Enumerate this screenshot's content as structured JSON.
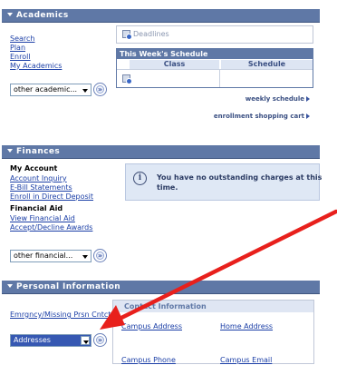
{
  "academics": {
    "title": "Academics",
    "links": [
      "Search",
      "Plan",
      "Enroll",
      "My Academics"
    ],
    "dropdown_value": "other academic...",
    "deadlines_label": "Deadlines",
    "schedule_title": "This Week's Schedule",
    "schedule_columns": [
      "Class",
      "Schedule"
    ],
    "weekly_schedule_link": "weekly schedule",
    "shopping_cart_link": "enrollment shopping cart"
  },
  "finances": {
    "title": "Finances",
    "my_account_heading": "My Account",
    "my_account_links": [
      "Account Inquiry",
      "E-Bill Statements",
      "Enroll in Direct Deposit"
    ],
    "financial_aid_heading": "Financial Aid",
    "financial_aid_links": [
      "View Financial Aid",
      "Accept/Decline Awards"
    ],
    "dropdown_value": "other financial...",
    "notice_line1": "You have no outstanding charges at this",
    "notice_line2": "time."
  },
  "personal": {
    "title": "Personal Information",
    "emergency_link": "Emrgncy/Missing Prsn Cntct",
    "dropdown_value": "Addresses",
    "contact_header": "Contact Information",
    "contact_links": [
      "Campus Address",
      "Home Address",
      "Campus Phone",
      "Campus Email"
    ]
  },
  "colors": {
    "header_bg": "#5f78a6",
    "link": "#1a3ea6",
    "selected_dropdown": "#3658b2",
    "annotation_arrow": "#e8201c"
  },
  "icons": [
    "chevron-down-icon",
    "go-arrow-icon",
    "calendar-icon",
    "info-icon",
    "right-arrow-icon",
    "dropdown-arrow-icon"
  ]
}
